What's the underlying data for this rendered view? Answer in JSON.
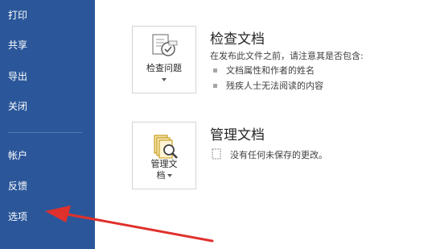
{
  "sidebar": {
    "items": [
      {
        "label": "打印"
      },
      {
        "label": "共享"
      },
      {
        "label": "导出"
      },
      {
        "label": "关闭"
      },
      {
        "label": "帐户"
      },
      {
        "label": "反馈"
      },
      {
        "label": "选项"
      }
    ]
  },
  "inspect": {
    "button_label": "检查问题",
    "title": "检查文档",
    "description": "在发布此文件之前，请注意其是否包含:",
    "bullets": [
      "文档属性和作者的姓名",
      "残疾人士无法阅读的内容"
    ],
    "icon": "inspect-document-icon"
  },
  "manage": {
    "button_label_line1": "管理文",
    "button_label_line2": "档",
    "title": "管理文档",
    "status": "没有任何未保存的更改。",
    "icon": "manage-document-icon"
  },
  "annotation": {
    "arrow_color": "#e0302c"
  },
  "colors": {
    "sidebar_bg": "#2b579a",
    "sidebar_text": "#ffffff"
  }
}
